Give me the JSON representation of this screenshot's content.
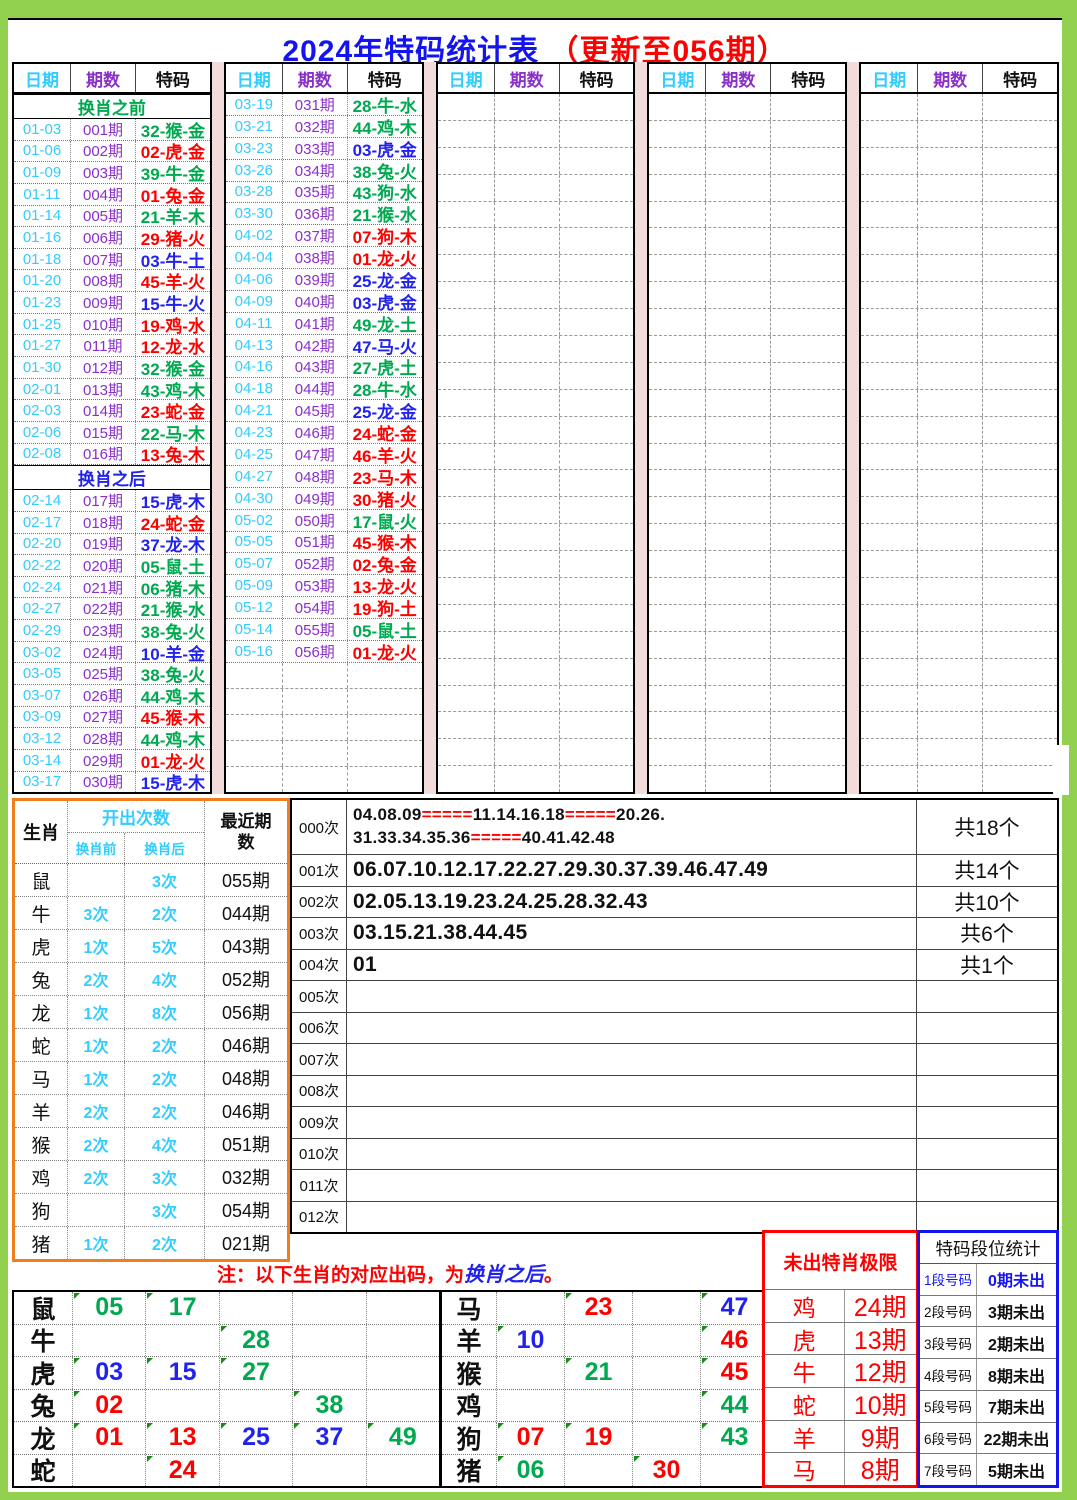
{
  "title": {
    "main": "2024年特码统计表",
    "update": "（更新至056期）"
  },
  "columns": {
    "date": "日期",
    "period": "期数",
    "code": "特码"
  },
  "sections": {
    "before": "换肖之前",
    "after": "换肖之后"
  },
  "palette": {
    "canvas_green": "#92D050",
    "separator_pink": "#F2DCDB",
    "date_cyan": "#33CCFF",
    "period_purple": "#8B2FC9",
    "code_red": "#FE0000",
    "code_green": "#00A94F",
    "code_blue": "#2222EE",
    "title_blue": "#1414F0",
    "stats_orange": "#F07D1E",
    "limit_red": "#FE0000",
    "segment_blue": "#1414F0"
  },
  "draws": {
    "g1_before": [
      {
        "date": "01-03",
        "period": "001期",
        "code": "32-猴-金",
        "k": "g"
      },
      {
        "date": "01-06",
        "period": "002期",
        "code": "02-虎-金",
        "k": "r"
      },
      {
        "date": "01-09",
        "period": "003期",
        "code": "39-牛-金",
        "k": "g"
      },
      {
        "date": "01-11",
        "period": "004期",
        "code": "01-兔-金",
        "k": "r"
      },
      {
        "date": "01-14",
        "period": "005期",
        "code": "21-羊-木",
        "k": "g"
      },
      {
        "date": "01-16",
        "period": "006期",
        "code": "29-猪-火",
        "k": "r"
      },
      {
        "date": "01-18",
        "period": "007期",
        "code": "03-牛-土",
        "k": "b"
      },
      {
        "date": "01-20",
        "period": "008期",
        "code": "45-羊-火",
        "k": "r"
      },
      {
        "date": "01-23",
        "period": "009期",
        "code": "15-牛-火",
        "k": "b"
      },
      {
        "date": "01-25",
        "period": "010期",
        "code": "19-鸡-水",
        "k": "r"
      },
      {
        "date": "01-27",
        "period": "011期",
        "code": "12-龙-水",
        "k": "r"
      },
      {
        "date": "01-30",
        "period": "012期",
        "code": "32-猴-金",
        "k": "g"
      },
      {
        "date": "02-01",
        "period": "013期",
        "code": "43-鸡-木",
        "k": "g"
      },
      {
        "date": "02-03",
        "period": "014期",
        "code": "23-蛇-金",
        "k": "r"
      },
      {
        "date": "02-06",
        "period": "015期",
        "code": "22-马-木",
        "k": "g"
      },
      {
        "date": "02-08",
        "period": "016期",
        "code": "13-兔-木",
        "k": "r"
      }
    ],
    "g1_after": [
      {
        "date": "02-14",
        "period": "017期",
        "code": "15-虎-木",
        "k": "b"
      },
      {
        "date": "02-17",
        "period": "018期",
        "code": "24-蛇-金",
        "k": "r"
      },
      {
        "date": "02-20",
        "period": "019期",
        "code": "37-龙-木",
        "k": "b"
      },
      {
        "date": "02-22",
        "period": "020期",
        "code": "05-鼠-土",
        "k": "g"
      },
      {
        "date": "02-24",
        "period": "021期",
        "code": "06-猪-木",
        "k": "g"
      },
      {
        "date": "02-27",
        "period": "022期",
        "code": "21-猴-水",
        "k": "g"
      },
      {
        "date": "02-29",
        "period": "023期",
        "code": "38-兔-火",
        "k": "g"
      },
      {
        "date": "03-02",
        "period": "024期",
        "code": "10-羊-金",
        "k": "b"
      },
      {
        "date": "03-05",
        "period": "025期",
        "code": "38-兔-火",
        "k": "g"
      },
      {
        "date": "03-07",
        "period": "026期",
        "code": "44-鸡-木",
        "k": "g"
      },
      {
        "date": "03-09",
        "period": "027期",
        "code": "45-猴-木",
        "k": "r"
      },
      {
        "date": "03-12",
        "period": "028期",
        "code": "44-鸡-木",
        "k": "g"
      },
      {
        "date": "03-14",
        "period": "029期",
        "code": "01-龙-火",
        "k": "r"
      },
      {
        "date": "03-17",
        "period": "030期",
        "code": "15-虎-木",
        "k": "b"
      }
    ],
    "g2": [
      {
        "date": "03-19",
        "period": "031期",
        "code": "28-牛-水",
        "k": "g"
      },
      {
        "date": "03-21",
        "period": "032期",
        "code": "44-鸡-木",
        "k": "g"
      },
      {
        "date": "03-23",
        "period": "033期",
        "code": "03-虎-金",
        "k": "b"
      },
      {
        "date": "03-26",
        "period": "034期",
        "code": "38-兔-火",
        "k": "g"
      },
      {
        "date": "03-28",
        "period": "035期",
        "code": "43-狗-水",
        "k": "g"
      },
      {
        "date": "03-30",
        "period": "036期",
        "code": "21-猴-水",
        "k": "g"
      },
      {
        "date": "04-02",
        "period": "037期",
        "code": "07-狗-木",
        "k": "r"
      },
      {
        "date": "04-04",
        "period": "038期",
        "code": "01-龙-火",
        "k": "r"
      },
      {
        "date": "04-06",
        "period": "039期",
        "code": "25-龙-金",
        "k": "b"
      },
      {
        "date": "04-09",
        "period": "040期",
        "code": "03-虎-金",
        "k": "b"
      },
      {
        "date": "04-11",
        "period": "041期",
        "code": "49-龙-土",
        "k": "g"
      },
      {
        "date": "04-13",
        "period": "042期",
        "code": "47-马-火",
        "k": "b"
      },
      {
        "date": "04-16",
        "period": "043期",
        "code": "27-虎-土",
        "k": "g"
      },
      {
        "date": "04-18",
        "period": "044期",
        "code": "28-牛-水",
        "k": "g"
      },
      {
        "date": "04-21",
        "period": "045期",
        "code": "25-龙-金",
        "k": "b"
      },
      {
        "date": "04-23",
        "period": "046期",
        "code": "24-蛇-金",
        "k": "r"
      },
      {
        "date": "04-25",
        "period": "047期",
        "code": "46-羊-火",
        "k": "r"
      },
      {
        "date": "04-27",
        "period": "048期",
        "code": "23-马-木",
        "k": "r"
      },
      {
        "date": "04-30",
        "period": "049期",
        "code": "30-猪-火",
        "k": "r"
      },
      {
        "date": "05-02",
        "period": "050期",
        "code": "17-鼠-火",
        "k": "g"
      },
      {
        "date": "05-05",
        "period": "051期",
        "code": "45-猴-木",
        "k": "r"
      },
      {
        "date": "05-07",
        "period": "052期",
        "code": "02-兔-金",
        "k": "r"
      },
      {
        "date": "05-09",
        "period": "053期",
        "code": "13-龙-火",
        "k": "r"
      },
      {
        "date": "05-12",
        "period": "054期",
        "code": "19-狗-土",
        "k": "r"
      },
      {
        "date": "05-14",
        "period": "055期",
        "code": "05-鼠-土",
        "k": "g"
      },
      {
        "date": "05-16",
        "period": "056期",
        "code": "01-龙-火",
        "k": "r"
      }
    ]
  },
  "stats": {
    "header": {
      "zodiac": "生肖",
      "count": "开出次数",
      "before": "换肖前",
      "after": "换肖后",
      "recent": "最近期数"
    },
    "rows": [
      {
        "z": "鼠",
        "b": "",
        "a": "3次",
        "p": "055期"
      },
      {
        "z": "牛",
        "b": "3次",
        "a": "2次",
        "p": "044期"
      },
      {
        "z": "虎",
        "b": "1次",
        "a": "5次",
        "p": "043期"
      },
      {
        "z": "兔",
        "b": "2次",
        "a": "4次",
        "p": "052期"
      },
      {
        "z": "龙",
        "b": "1次",
        "a": "8次",
        "p": "056期"
      },
      {
        "z": "蛇",
        "b": "1次",
        "a": "2次",
        "p": "046期"
      },
      {
        "z": "马",
        "b": "1次",
        "a": "2次",
        "p": "048期"
      },
      {
        "z": "羊",
        "b": "2次",
        "a": "2次",
        "p": "046期"
      },
      {
        "z": "猴",
        "b": "2次",
        "a": "4次",
        "p": "051期"
      },
      {
        "z": "鸡",
        "b": "2次",
        "a": "3次",
        "p": "032期"
      },
      {
        "z": "狗",
        "b": "",
        "a": "3次",
        "p": "054期"
      },
      {
        "z": "猪",
        "b": "1次",
        "a": "2次",
        "p": "021期"
      }
    ]
  },
  "freq": {
    "zero": {
      "label": "000次",
      "count": "共18个",
      "line1": [
        {
          "t": "04.08.09",
          "k": "k"
        },
        {
          "t": "=====",
          "k": "r"
        },
        {
          "t": "11.14.16.18",
          "k": "k"
        },
        {
          "t": "=====",
          "k": "r"
        },
        {
          "t": "20.26.",
          "k": "k"
        }
      ],
      "line2": [
        {
          "t": "31.33.34.35.36",
          "k": "k"
        },
        {
          "t": "=====",
          "k": "r"
        },
        {
          "t": "40.41.42.48",
          "k": "k"
        }
      ]
    },
    "rows": [
      {
        "label": "001次",
        "nums": "06.07.10.12.17.22.27.29.30.37.39.46.47.49",
        "count": "共14个"
      },
      {
        "label": "002次",
        "nums": "02.05.13.19.23.24.25.28.32.43",
        "count": "共10个"
      },
      {
        "label": "003次",
        "nums": "03.15.21.38.44.45",
        "count": "共6个"
      },
      {
        "label": "004次",
        "nums": "01",
        "count": "共1个"
      },
      {
        "label": "005次",
        "nums": "",
        "count": ""
      },
      {
        "label": "006次",
        "nums": "",
        "count": ""
      },
      {
        "label": "007次",
        "nums": "",
        "count": ""
      },
      {
        "label": "008次",
        "nums": "",
        "count": ""
      },
      {
        "label": "009次",
        "nums": "",
        "count": ""
      },
      {
        "label": "010次",
        "nums": "",
        "count": ""
      },
      {
        "label": "011次",
        "nums": "",
        "count": ""
      },
      {
        "label": "012次",
        "nums": "",
        "count": ""
      }
    ]
  },
  "note": {
    "pre": "注：以下生肖的对应出码，为",
    "em": "换肖之后",
    "post": "。"
  },
  "zodiac_left": [
    {
      "z": "鼠",
      "c1": "05",
      "k1": "g",
      "c2": "17",
      "k2": "g",
      "c3": "",
      "k3": "",
      "c4": "",
      "k4": "",
      "c5": "",
      "k5": ""
    },
    {
      "z": "牛",
      "c1": "",
      "k1": "",
      "c2": "",
      "k2": "",
      "c3": "28",
      "k3": "g",
      "c4": "",
      "k4": "",
      "c5": "",
      "k5": ""
    },
    {
      "z": "虎",
      "c1": "03",
      "k1": "b",
      "c2": "15",
      "k2": "b",
      "c3": "27",
      "k3": "g",
      "c4": "",
      "k4": "",
      "c5": "",
      "k5": ""
    },
    {
      "z": "兔",
      "c1": "02",
      "k1": "r",
      "c2": "",
      "k2": "",
      "c3": "",
      "k3": "",
      "c4": "38",
      "k4": "g",
      "c5": "",
      "k5": ""
    },
    {
      "z": "龙",
      "c1": "01",
      "k1": "r",
      "c2": "13",
      "k2": "r",
      "c3": "25",
      "k3": "b",
      "c4": "37",
      "k4": "b",
      "c5": "49",
      "k5": "g"
    },
    {
      "z": "蛇",
      "c1": "",
      "k1": "",
      "c2": "24",
      "k2": "r",
      "c3": "",
      "k3": "",
      "c4": "",
      "k4": "",
      "c5": "",
      "k5": ""
    }
  ],
  "zodiac_right": [
    {
      "z": "马",
      "c1": "",
      "k1": "",
      "c2": "23",
      "k2": "r",
      "c3": "",
      "k3": "",
      "c4": "47",
      "k4": "b"
    },
    {
      "z": "羊",
      "c1": "10",
      "k1": "b",
      "c2": "",
      "k2": "",
      "c3": "",
      "k3": "",
      "c4": "46",
      "k4": "r"
    },
    {
      "z": "猴",
      "c1": "",
      "k1": "",
      "c2": "21",
      "k2": "g",
      "c3": "",
      "k3": "",
      "c4": "45",
      "k4": "r"
    },
    {
      "z": "鸡",
      "c1": "",
      "k1": "",
      "c2": "",
      "k2": "",
      "c3": "",
      "k3": "",
      "c4": "44",
      "k4": "g"
    },
    {
      "z": "狗",
      "c1": "07",
      "k1": "r",
      "c2": "19",
      "k2": "r",
      "c3": "",
      "k3": "",
      "c4": "43",
      "k4": "g"
    },
    {
      "z": "猪",
      "c1": "06",
      "k1": "g",
      "c2": "",
      "k2": "",
      "c3": "30",
      "k3": "r",
      "c4": "",
      "k4": ""
    }
  ],
  "limits": {
    "title": "未出特肖极限",
    "rows": [
      {
        "z": "鸡",
        "p": "24期"
      },
      {
        "z": "虎",
        "p": "13期"
      },
      {
        "z": "牛",
        "p": "12期"
      },
      {
        "z": "蛇",
        "p": "10期"
      },
      {
        "z": "羊",
        "p": "9期"
      },
      {
        "z": "马",
        "p": "8期"
      }
    ]
  },
  "segments": {
    "title": "特码段位统计",
    "rows": [
      {
        "s": "1段号码",
        "v": "0期未出",
        "k": "b"
      },
      {
        "s": "2段号码",
        "v": "3期未出",
        "k": ""
      },
      {
        "s": "3段号码",
        "v": "2期未出",
        "k": ""
      },
      {
        "s": "4段号码",
        "v": "8期未出",
        "k": ""
      },
      {
        "s": "5段号码",
        "v": "7期未出",
        "k": ""
      },
      {
        "s": "6段号码",
        "v": "22期未出",
        "k": ""
      },
      {
        "s": "7段号码",
        "v": "5期未出",
        "k": ""
      }
    ]
  }
}
